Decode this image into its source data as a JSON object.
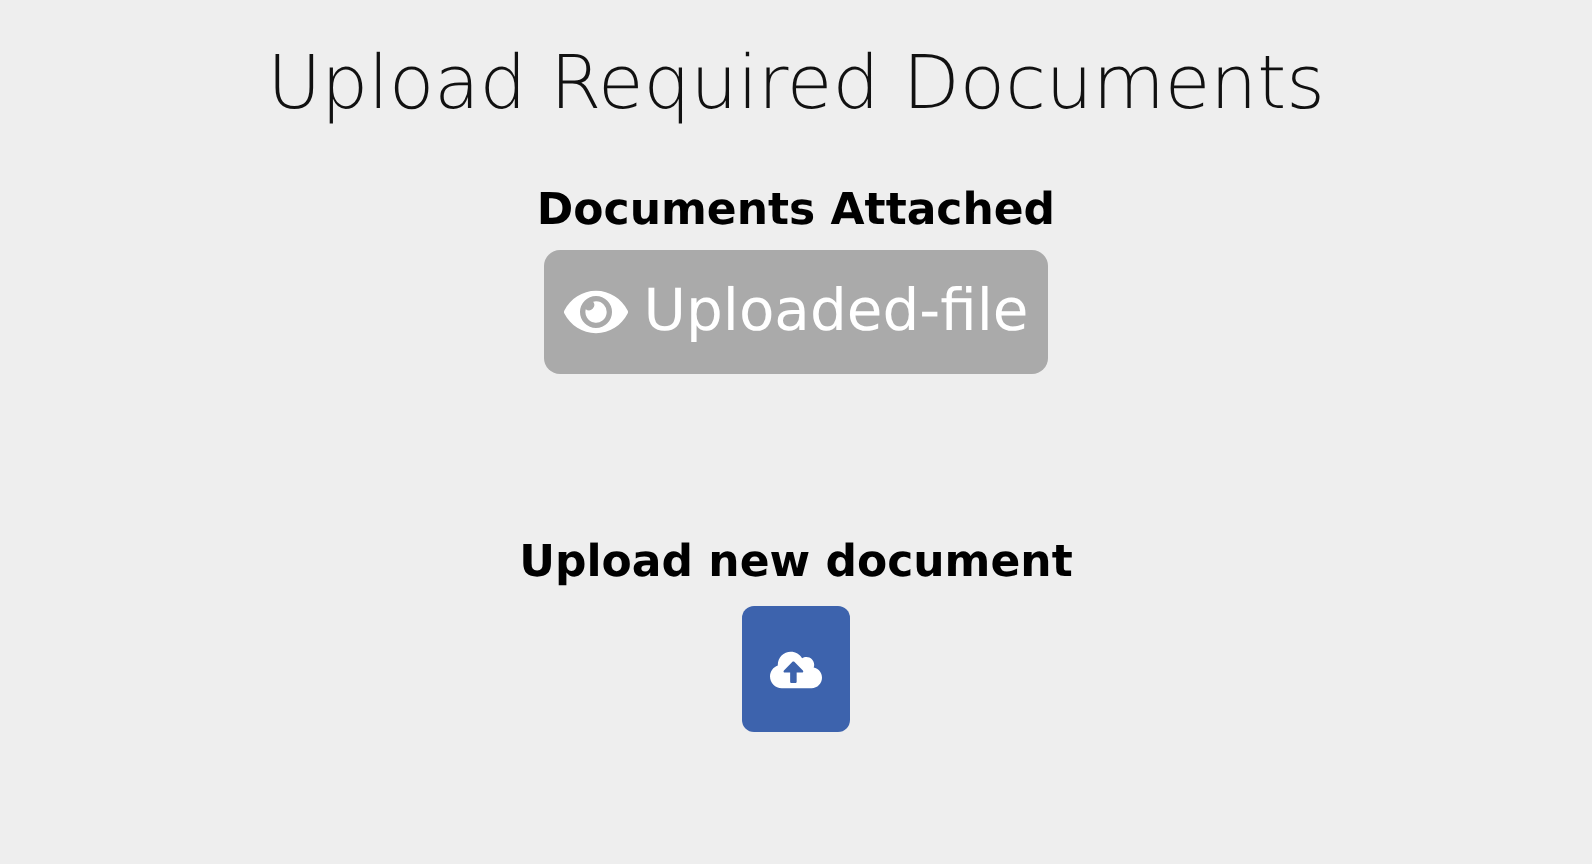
{
  "title": "Upload Required Documents",
  "attached": {
    "heading": "Documents Attached",
    "files": [
      {
        "label": "Uploaded-file"
      }
    ]
  },
  "upload": {
    "heading": "Upload new document"
  }
}
